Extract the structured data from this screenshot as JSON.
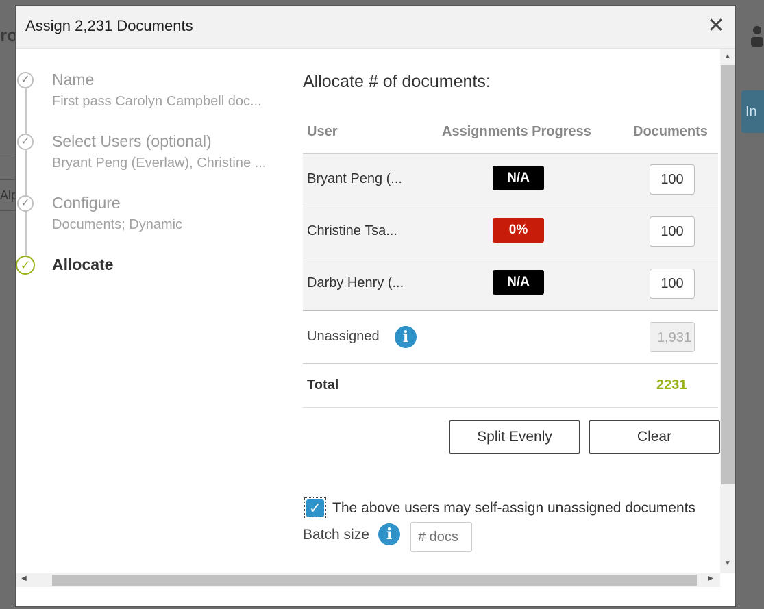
{
  "background": {
    "left_edge_text": "ro",
    "right_button_text": "In",
    "left_input_text": "Alp"
  },
  "dialog": {
    "title": "Assign 2,231 Documents",
    "close_label": "✕"
  },
  "steps": [
    {
      "title": "Name",
      "subtitle": "First pass Carolyn Campbell doc...",
      "status": "done"
    },
    {
      "title": "Select Users (optional)",
      "subtitle": "Bryant Peng (Everlaw), Christine ...",
      "status": "done"
    },
    {
      "title": "Configure",
      "subtitle": "Documents; Dynamic",
      "status": "done"
    },
    {
      "title": "Allocate",
      "subtitle": "",
      "status": "active"
    }
  ],
  "allocate": {
    "heading": "Allocate # of documents:",
    "columns": {
      "user": "User",
      "progress": "Assignments Progress",
      "documents": "Documents"
    },
    "rows": [
      {
        "user": "Bryant Peng (...",
        "progress": "N/A",
        "progress_color": "#000000",
        "documents": "100"
      },
      {
        "user": "Christine Tsa...",
        "progress": "0%",
        "progress_color": "#c71c0a",
        "documents": "100"
      },
      {
        "user": "Darby Henry (...",
        "progress": "N/A",
        "progress_color": "#000000",
        "documents": "100"
      }
    ],
    "unassigned": {
      "label": "Unassigned",
      "value": "1,931"
    },
    "total": {
      "label": "Total",
      "value": "2231"
    },
    "split_button": "Split Evenly",
    "clear_button": "Clear",
    "self_assign": {
      "checked": true,
      "label": "The above users may self-assign unassigned documents"
    },
    "batch": {
      "label": "Batch size",
      "placeholder": "# docs"
    }
  },
  "colors": {
    "accent_green": "#9ab21c",
    "info_blue": "#2f93c9",
    "danger_red": "#c71c0a"
  }
}
